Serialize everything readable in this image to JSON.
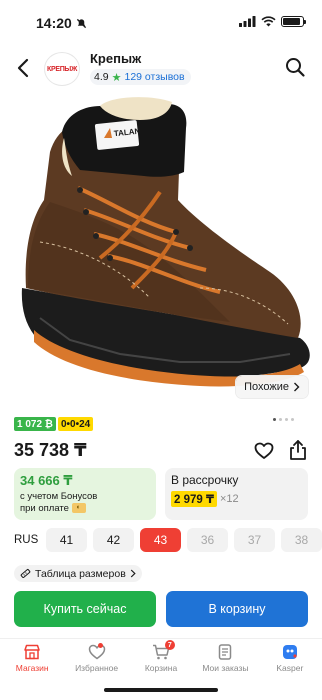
{
  "status_bar": {
    "time": "14:20"
  },
  "header": {
    "shop_logo_text": "КРЕПЫЖ",
    "shop_name": "Крепыж",
    "rating": "4.9",
    "reviews": "129 отзывов"
  },
  "gallery": {
    "similar_label": "Похожие",
    "boot_label": "TALAN",
    "total_images": 4,
    "current_image": 1
  },
  "badges": {
    "green": "1 072 ₿",
    "yellow": "0•0•24"
  },
  "price": "35 738 ₸",
  "bonus_card": {
    "price": "34 666 ₸",
    "note_line1": "с учетом Бонусов",
    "note_line2": "при оплате"
  },
  "installment_card": {
    "title": "В рассрочку",
    "amount": "2 979 ₸",
    "months": "×12"
  },
  "sizes": {
    "label": "RUS",
    "options": [
      {
        "value": "41",
        "state": "available"
      },
      {
        "value": "42",
        "state": "available"
      },
      {
        "value": "43",
        "state": "selected"
      },
      {
        "value": "36",
        "state": "unavailable"
      },
      {
        "value": "37",
        "state": "unavailable"
      },
      {
        "value": "38",
        "state": "unavailable"
      }
    ]
  },
  "size_table_label": "Таблица размеров",
  "buttons": {
    "buy": "Купить сейчас",
    "cart": "В корзину"
  },
  "tab_bar": {
    "items": [
      {
        "label": "Магазин",
        "icon": "shop-icon",
        "active": true
      },
      {
        "label": "Избранное",
        "icon": "heart-icon",
        "active": false
      },
      {
        "label": "Корзина",
        "icon": "cart-icon",
        "active": false,
        "badge": "7"
      },
      {
        "label": "Мои заказы",
        "icon": "orders-icon",
        "active": false
      },
      {
        "label": "Kasper",
        "icon": "kasper-icon",
        "active": false
      }
    ]
  },
  "colors": {
    "accent_red": "#ef3f34",
    "buy_green": "#21b04b",
    "cart_blue": "#1f73d6",
    "bonus_yellow": "#ffd900"
  }
}
